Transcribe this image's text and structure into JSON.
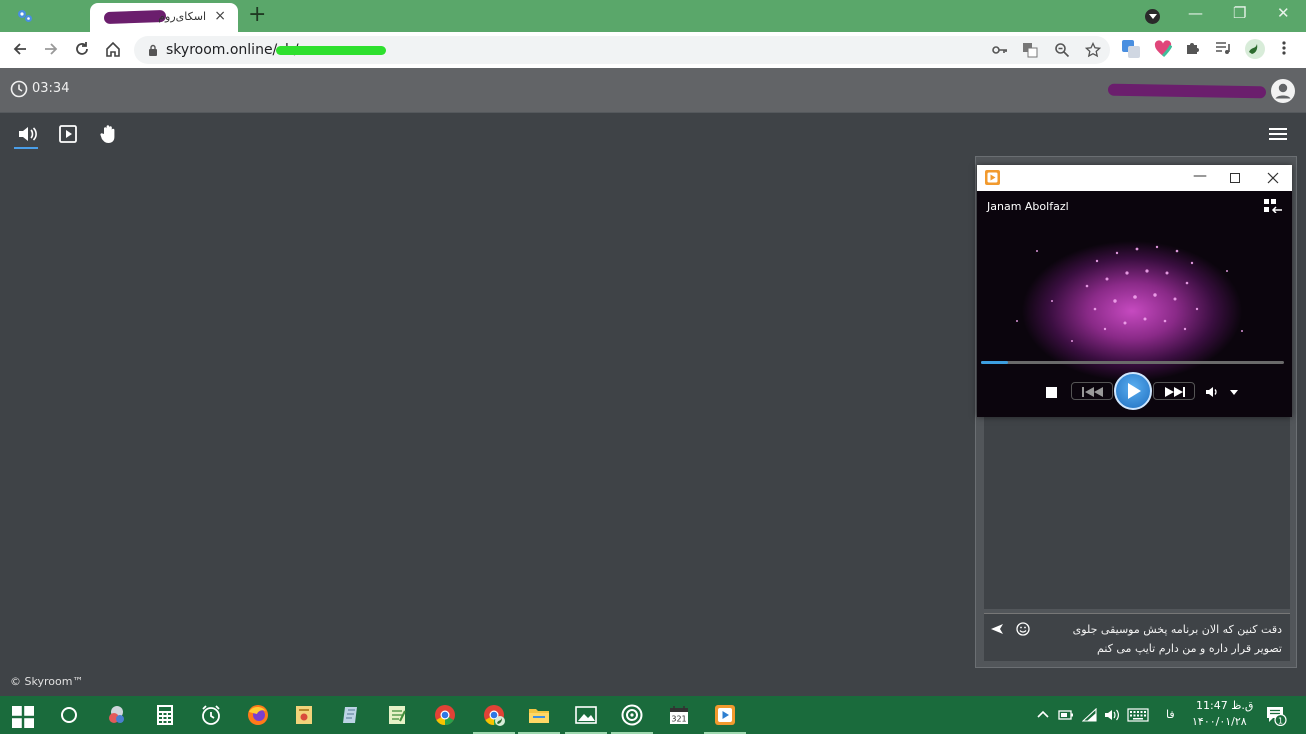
{
  "browser": {
    "tab_title": "اسکای‌روم",
    "tab_close": "×",
    "new_tab": "+",
    "url": "skyroom.online/ch/",
    "window_min": "—",
    "window_max": "❐",
    "window_close": "✕"
  },
  "app": {
    "timer": "03:34",
    "brand": "© Skyroom™"
  },
  "player": {
    "track_title": "Janam Abolfazl",
    "progress": 0.09,
    "accent": "#3d9fe0"
  },
  "chat": {
    "header": "",
    "message": "دقت کنین که الان برنامه پخش موسیقی جلوی تصویر قرار داره و من دارم تایپ می کنم"
  },
  "taskbar": {
    "language": "فا",
    "time": "ق.ظ 11:47",
    "date": "۱۴۰۰/۰۱/۲۸",
    "notification_count": "1"
  },
  "colors": {
    "tabstrip": "#5aa76a",
    "app_header": "#626467",
    "app_bg": "#3f4347",
    "taskbar": "#1a6b3c"
  }
}
